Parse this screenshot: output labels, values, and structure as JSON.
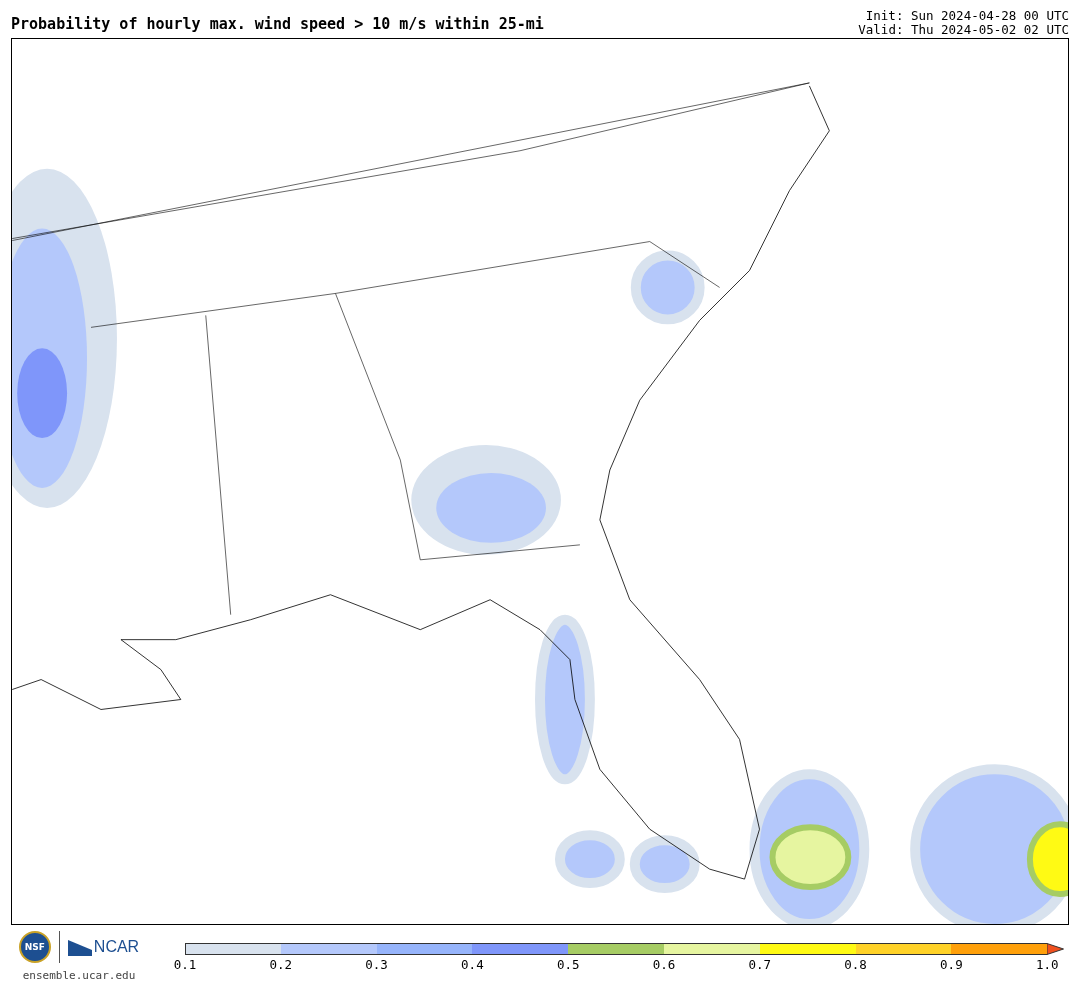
{
  "header": {
    "title": "Probability of hourly max. wind speed > 10 m/s within 25-mi",
    "init": "Init: Sun 2024-04-28 00 UTC",
    "valid": "Valid: Thu 2024-05-02 02 UTC"
  },
  "footer": {
    "logo_left": "NSF",
    "logo_right": "NCAR",
    "url": "ensemble.ucar.edu"
  },
  "colorbar": {
    "bins": [
      {
        "color": "#d8e2ee"
      },
      {
        "color": "#b4c8fb"
      },
      {
        "color": "#96b4fb"
      },
      {
        "color": "#7f96fa"
      },
      {
        "color": "#a6cc64"
      },
      {
        "color": "#e6f5a0"
      },
      {
        "color": "#fffa14"
      },
      {
        "color": "#ffd228"
      },
      {
        "color": "#ffa00a"
      }
    ],
    "extend": {
      "color": "#f0501e"
    },
    "ticks": [
      "0.1",
      "0.2",
      "0.3",
      "0.4",
      "0.5",
      "0.6",
      "0.7",
      "0.8",
      "0.9",
      "1.0"
    ]
  }
}
